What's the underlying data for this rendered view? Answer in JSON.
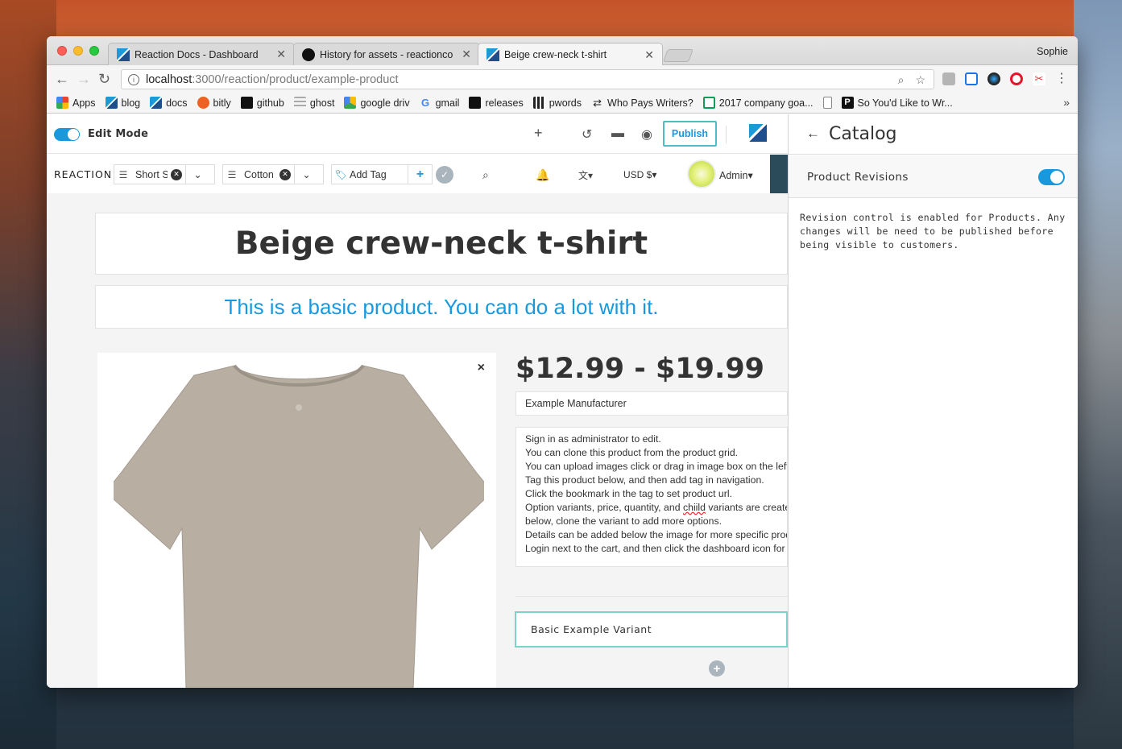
{
  "browser": {
    "tabs": [
      {
        "title": "Reaction Docs - Dashboard",
        "icon": "reaction-icon",
        "active": false
      },
      {
        "title": "History for assets - reactionco",
        "icon": "github-icon",
        "active": false
      },
      {
        "title": "Beige crew-neck t-shirt",
        "icon": "reaction-icon",
        "active": true
      }
    ],
    "profile_name": "Sophie",
    "url_host": "localhost",
    "url_path": ":3000/reaction/product/example-product",
    "bookmarks": [
      {
        "label": "Apps",
        "icon": "apps-grid-icon"
      },
      {
        "label": "blog",
        "icon": "reaction-icon"
      },
      {
        "label": "docs",
        "icon": "reaction-icon"
      },
      {
        "label": "bitly",
        "icon": "bitly-icon"
      },
      {
        "label": "github",
        "icon": "github-icon"
      },
      {
        "label": "ghost",
        "icon": "ghost-icon"
      },
      {
        "label": "google driv",
        "icon": "google-drive-icon"
      },
      {
        "label": "gmail",
        "icon": "google-icon"
      },
      {
        "label": "releases",
        "icon": "github-icon"
      },
      {
        "label": "pwords",
        "icon": "pwords-icon"
      },
      {
        "label": "Who Pays Writers?",
        "icon": "arrows-icon"
      },
      {
        "label": "2017 company goa...",
        "icon": "sheets-icon"
      },
      {
        "label": "",
        "icon": "page-icon"
      },
      {
        "label": "So You'd Like to Wr...",
        "icon": "p-icon"
      }
    ],
    "bookmarks_more": "»"
  },
  "admin_bar": {
    "edit_mode_label": "Edit Mode",
    "edit_mode_on": true,
    "publish_label": "Publish"
  },
  "nav": {
    "shop_name": "REACTION",
    "tags": [
      {
        "label": "Short Sl"
      },
      {
        "label": "Cotton"
      }
    ],
    "add_tag_placeholder": "Add Tag",
    "currency": "USD $",
    "currency_caret": "▾",
    "user_name": "Admin",
    "user_caret": "▾"
  },
  "product": {
    "title": "Beige crew-neck t-shirt",
    "subtitle": "This is a basic product. You can do a lot with it.",
    "price": "$12.99 - $19.99",
    "vendor": "Example Manufacturer",
    "description": [
      "Sign in as administrator to edit.",
      "You can clone this product from the product grid.",
      "You can upload images click or drag in image box on the left he",
      "Tag this product below, and then add tag in navigation.",
      "Click the bookmark in the tag to set product url.",
      "Option variants, price, quantity, and ",
      "below, clone the variant to add more options.",
      "Details can be added below the image for more specific produ",
      " Login next to the cart, and then click the dashboard icon for m"
    ],
    "description_misspelled_word": "chiild",
    "description_line6_tail": " variants are created",
    "variant_label": "Basic Example Variant",
    "image_close": "×",
    "shirt_color": "#b8aea2"
  },
  "side_panel": {
    "title": "Catalog",
    "revisions_label": "Product Revisions",
    "revisions_enabled": true,
    "note": "Revision control is enabled for Products. Any changes will be need to be published before being visible to customers."
  },
  "colors": {
    "accent": "#1999dd",
    "publish_border": "#4fbdc5",
    "variant_border": "#7ed3c8",
    "nav_dark": "#2b4a5a"
  }
}
